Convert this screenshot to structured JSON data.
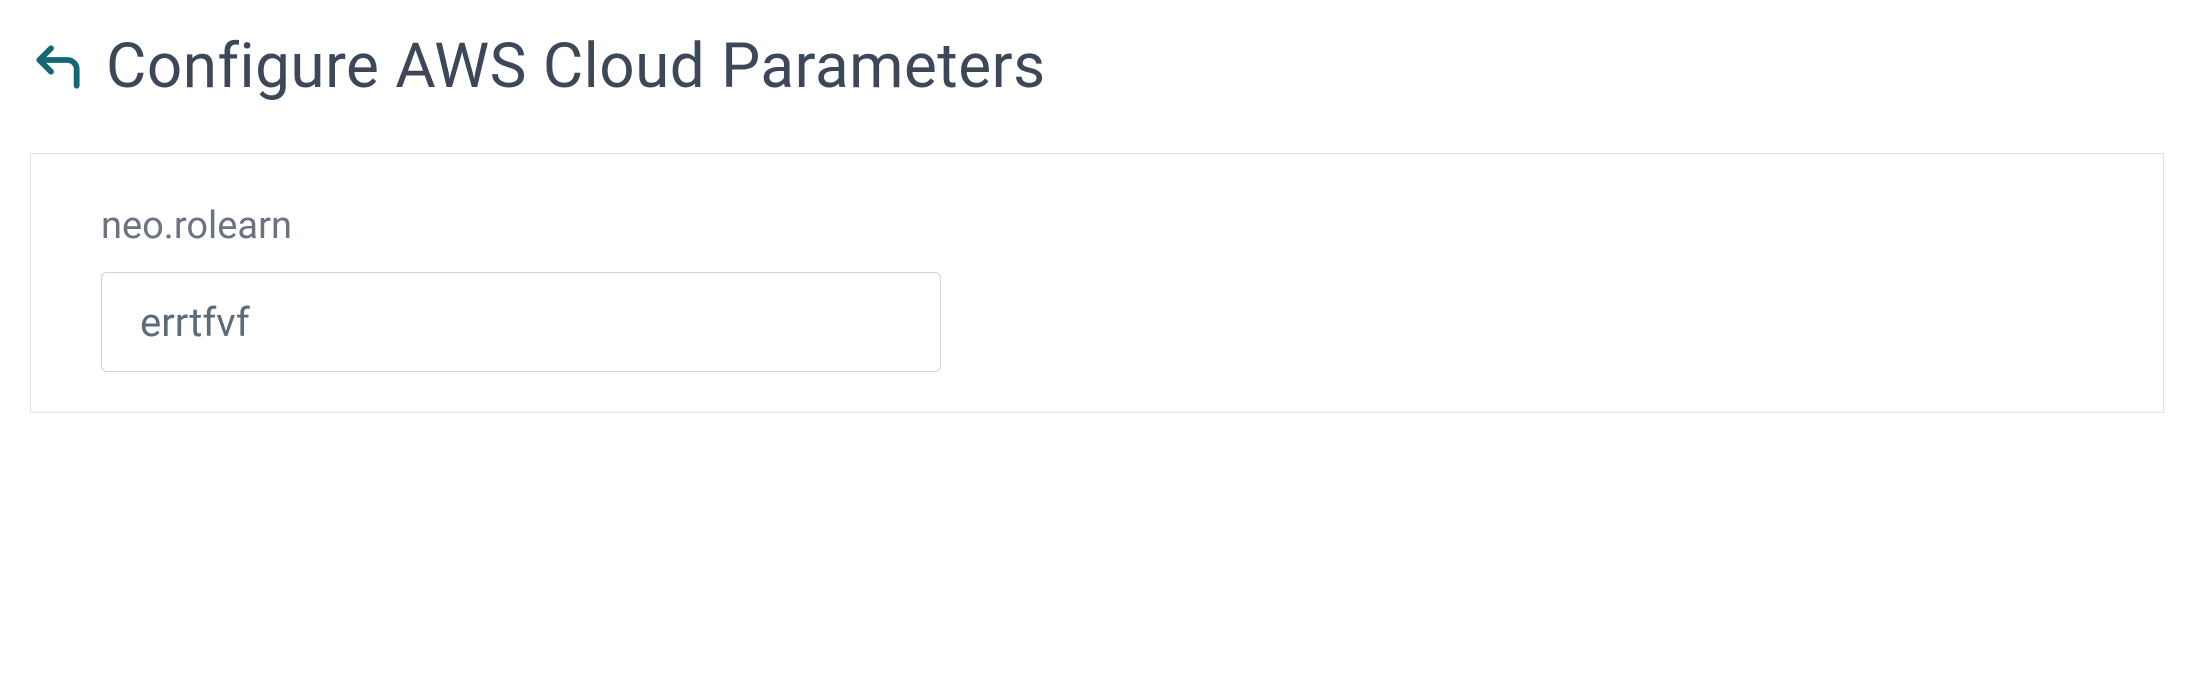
{
  "header": {
    "title": "Configure AWS Cloud Parameters"
  },
  "form": {
    "fields": [
      {
        "label": "neo.rolearn",
        "value": "errtfvf"
      }
    ]
  }
}
